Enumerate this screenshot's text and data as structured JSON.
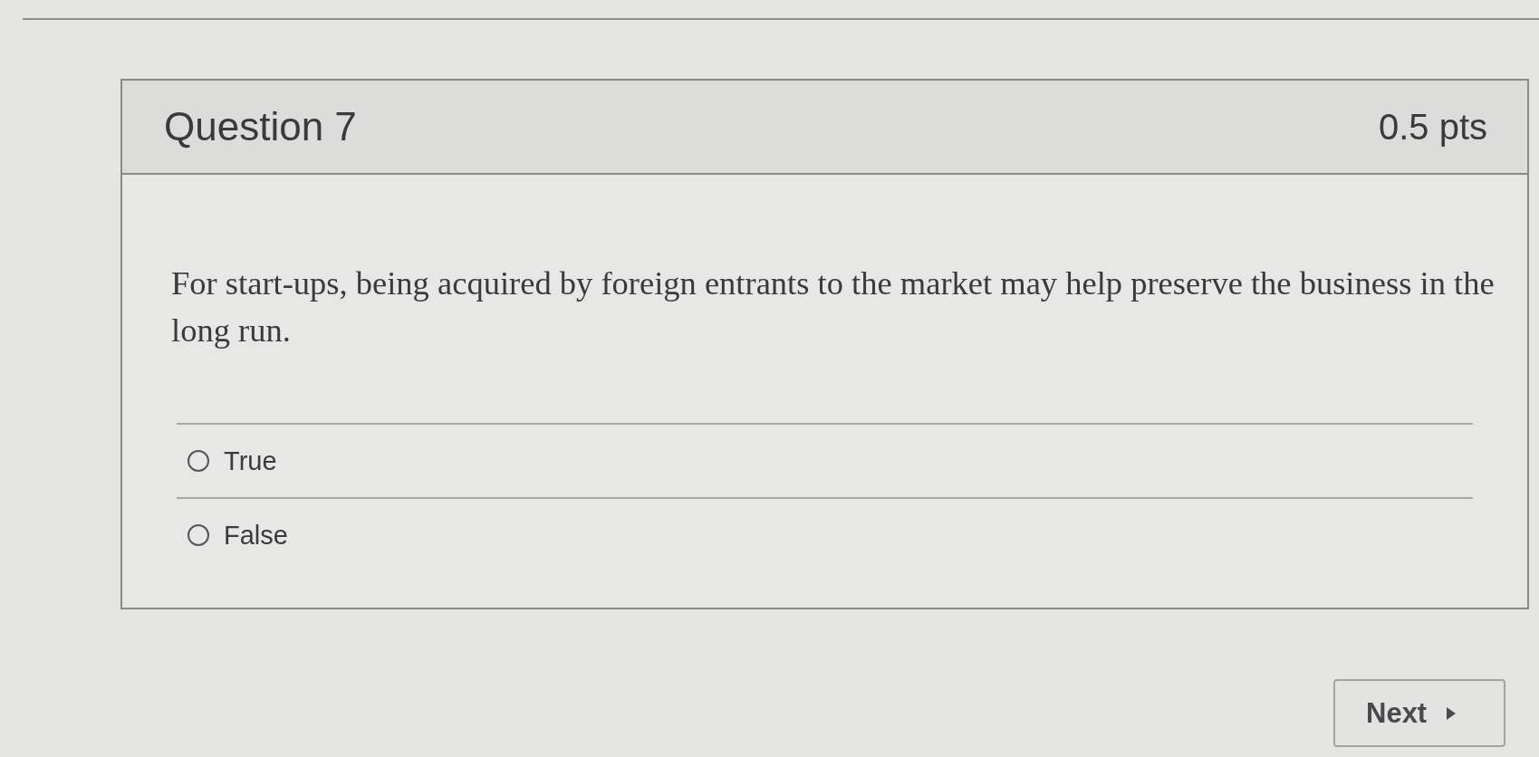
{
  "question": {
    "title": "Question 7",
    "points": "0.5 pts",
    "text": "For start-ups, being acquired by foreign entrants to the market may help preserve the business in the long run."
  },
  "answers": [
    {
      "label": "True",
      "selected": false
    },
    {
      "label": "False",
      "selected": false
    }
  ],
  "next_button": {
    "label": "Next"
  }
}
